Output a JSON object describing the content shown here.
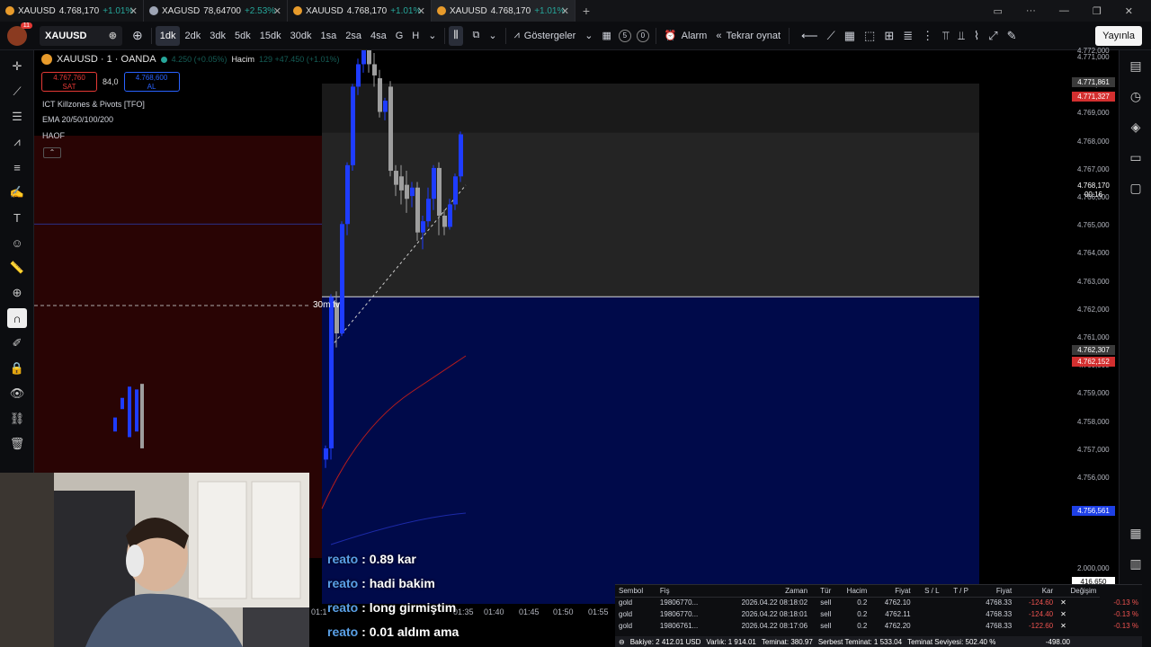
{
  "tabs": [
    {
      "symbol": "XAUUSD",
      "price": "4.768,170",
      "change": "+1.01%",
      "active": false
    },
    {
      "symbol": "XAGUSD",
      "price": "78,64700",
      "change": "+2.53%",
      "active": false
    },
    {
      "symbol": "XAUUSD",
      "price": "4.768,170",
      "change": "+1.01%",
      "active": false
    },
    {
      "symbol": "XAUUSD",
      "price": "4.768,170",
      "change": "+1.01%",
      "active": true
    }
  ],
  "toolbar": {
    "notif_count": "11",
    "symbol": "XAUUSD",
    "timeframes": [
      "1dk",
      "2dk",
      "3dk",
      "5dk",
      "15dk",
      "30dk",
      "1sa",
      "2sa",
      "4sa",
      "G",
      "H"
    ],
    "selected_timeframe": "1dk",
    "indicators_label": "Göstergeler",
    "circle_a": "5",
    "circle_b": "0",
    "alarm_label": "Alarm",
    "replay_label": "Tekrar oynat",
    "publish_label": "Yayınla"
  },
  "legend": {
    "title": "XAUUSD · 1 · OANDA",
    "volume_label": "Hacim",
    "faded_values": "4.250 (+0.05%)",
    "faded_volume": "129 +47.450 (+1.01%)",
    "sell_price": "4.767,760",
    "sell_label": "SAT",
    "spread": "84,0",
    "buy_price": "4.768,600",
    "buy_label": "AL",
    "indicators": [
      "ICT Killzones & Pivots [TFO]",
      "EMA 20/50/100/200",
      "HAOF"
    ]
  },
  "chart_annotation": "30m fv",
  "price_axis": {
    "ticks": [
      "4.771,000",
      "4.770,000",
      "4.769,000",
      "4.768,000",
      "4.767,000",
      "4.766,000",
      "4.765,000",
      "4.764,000",
      "4.763,000",
      "4.762,000",
      "4.761,000",
      "4.760,000",
      "4.759,000",
      "4.758,000",
      "4.757,000",
      "4.756,000"
    ],
    "top_partial": "4.772,000",
    "labels": [
      {
        "text": "4.771,861",
        "color": "#3a3a3a"
      },
      {
        "text": "4.771,327",
        "color": "#d32f2f"
      },
      {
        "text": "4.768,170",
        "color": "#000000"
      },
      {
        "text": "00:16",
        "color": "#000000"
      },
      {
        "text": "4.762,307",
        "color": "#3a3a3a"
      },
      {
        "text": "4.762,152",
        "color": "#d32f2f"
      },
      {
        "text": "4.756,561",
        "color": "#1e40e6"
      }
    ],
    "volume_tick": "2.000,000",
    "volume_label": "416,650"
  },
  "time_axis": [
    "01:1",
    "01:35",
    "01:40",
    "01:45",
    "01:50",
    "01:55"
  ],
  "chat": [
    {
      "user": "reato",
      "message": "0.89 kar"
    },
    {
      "user": "reato",
      "message": "hadi bakim"
    },
    {
      "user": "reato",
      "message": "long girmiştim"
    },
    {
      "user": "reato",
      "message": "0.01 aldım ama"
    }
  ],
  "trades": {
    "headers": [
      "Sembol",
      "Fiş",
      "Zaman",
      "Tür",
      "Hacim",
      "Fiyat",
      "S / L",
      "T / P",
      "Fiyat",
      "Kar",
      "Değişim"
    ],
    "rows": [
      [
        "gold",
        "19806770...",
        "2026.04.22 08:18:02",
        "sell",
        "0.2",
        "4762.10",
        "",
        "",
        "4768.33",
        "-124.60",
        "-0.13 %"
      ],
      [
        "gold",
        "19806770...",
        "2026.04.22 08:18:01",
        "sell",
        "0.2",
        "4762.11",
        "",
        "",
        "4768.33",
        "-124.40",
        "-0.13 %"
      ],
      [
        "gold",
        "19806761...",
        "2026.04.22 08:17:06",
        "sell",
        "0.2",
        "4762.20",
        "",
        "",
        "4768.33",
        "-122.60",
        "-0.13 %"
      ]
    ],
    "status": {
      "balance": "Bakiye: 2 412.01 USD",
      "equity": "Varlık: 1 914.01",
      "margin": "Teminat: 380.97",
      "free_margin": "Serbest Teminat: 1 533.04",
      "margin_level": "Teminat Seviyesi: 502.40 %",
      "total": "-498.00"
    }
  },
  "colors": {
    "bull": "#1e3cff",
    "bear": "#9e9e9e",
    "ema": "#b71c1c",
    "fvg_upper": "#242424",
    "fvg_lower": "#000a4a",
    "killzone": "#3a0606"
  }
}
